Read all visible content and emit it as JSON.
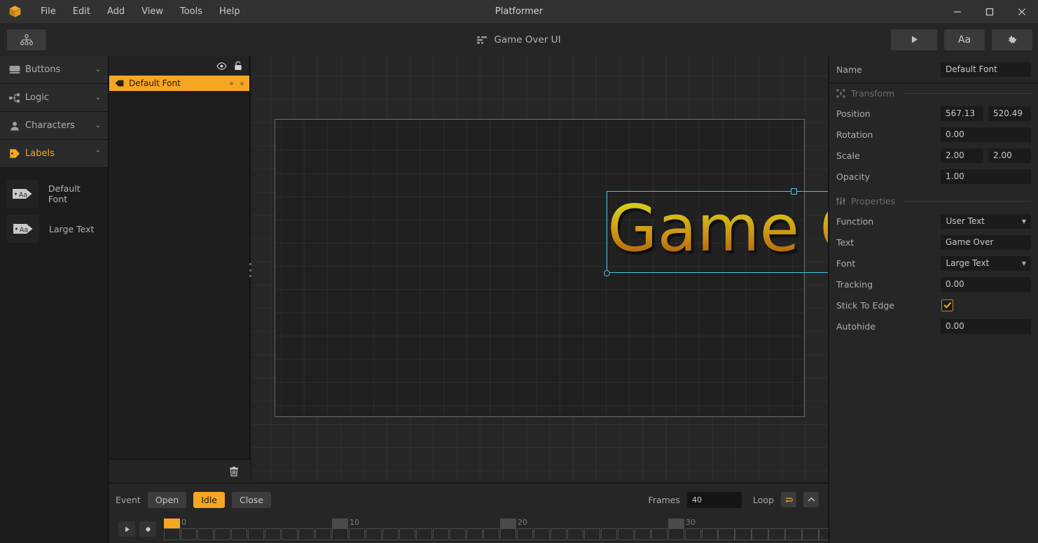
{
  "window": {
    "title": "Platformer",
    "app_icon": "box-logo-icon",
    "minimize_label": "–",
    "maximize_label": "□",
    "close_label": "✕"
  },
  "menubar": {
    "items": [
      {
        "label": "File"
      },
      {
        "label": "Edit"
      },
      {
        "label": "Add"
      },
      {
        "label": "View"
      },
      {
        "label": "Tools"
      },
      {
        "label": "Help"
      }
    ]
  },
  "toolbar": {
    "hierarchy_button_icon": "hierarchy-tree-icon",
    "document_icon": "list-icon",
    "document_title": "Game Over UI",
    "play_label": "▶",
    "text_label": "Aa",
    "settings_icon": "gear-icon"
  },
  "sidebar": {
    "categories": [
      {
        "label": "Buttons",
        "icon": "button-icon",
        "expanded": false,
        "chevron": "⌄"
      },
      {
        "label": "Logic",
        "icon": "logic-node-icon",
        "expanded": false,
        "chevron": "⌄"
      },
      {
        "label": "Characters",
        "icon": "person-icon",
        "expanded": false,
        "chevron": "⌄"
      },
      {
        "label": "Labels",
        "icon": "tag-icon",
        "expanded": true,
        "chevron": "⌃"
      }
    ],
    "assets": [
      {
        "label": "Default Font",
        "icon": "label-aa-icon",
        "thumb_text": "Aa"
      },
      {
        "label": "Large Text",
        "icon": "label-aa-icon",
        "thumb_text": "Aa"
      }
    ]
  },
  "layer_panel": {
    "visibility_icon": "eye-icon",
    "lock_icon": "lock-icon",
    "delete_icon": "trash-icon",
    "layers": [
      {
        "name": "Default Font",
        "icon": "label-layer-icon",
        "selected": true
      }
    ]
  },
  "canvas": {
    "selected_object": "Game Over",
    "object_text": "Game Over",
    "selection_color": "#4cc3e8",
    "text_gradient_top": "#d6e01c",
    "text_gradient_bottom": "#a0530c",
    "handles": [
      "top-center",
      "top-right",
      "middle-right",
      "origin-bottom-left"
    ]
  },
  "timeline": {
    "event_label": "Event",
    "events": [
      {
        "label": "Open",
        "active": false
      },
      {
        "label": "Idle",
        "active": true
      },
      {
        "label": "Close",
        "active": false
      }
    ],
    "frames_label": "Frames",
    "frames_value": "40",
    "loop_label": "Loop",
    "loop_icon": "loop-icon",
    "collapse_icon": "chevron-up-icon",
    "play_icon": "play-icon",
    "record_icon": "record-icon",
    "ruler_ticks": [
      "0",
      "10",
      "20",
      "30"
    ],
    "total_cells": 40,
    "current_frame": 0
  },
  "properties": {
    "name_label": "Name",
    "name_value": "Default Font",
    "transform": {
      "section_label": "Transform",
      "section_icon": "transform-icon",
      "rows": [
        {
          "label": "Position",
          "values": [
            "567.13",
            "520.49"
          ],
          "type": "pair"
        },
        {
          "label": "Rotation",
          "values": [
            "0.00"
          ],
          "type": "single"
        },
        {
          "label": "Scale",
          "values": [
            "2.00",
            "2.00"
          ],
          "type": "pair"
        },
        {
          "label": "Opacity",
          "values": [
            "1.00"
          ],
          "type": "single"
        }
      ]
    },
    "props": {
      "section_label": "Properties",
      "section_icon": "sliders-icon",
      "function_label": "Function",
      "function_value": "User Text",
      "text_label": "Text",
      "text_value": "Game Over",
      "font_label": "Font",
      "font_value": "Large Text",
      "tracking_label": "Tracking",
      "tracking_value": "0.00",
      "stick_label": "Stick To Edge",
      "stick_checked": true,
      "autohide_label": "Autohide",
      "autohide_value": "0.00"
    }
  },
  "colors": {
    "accent": "#f5a623",
    "selection": "#4cc3e8",
    "panel_bg": "#262626",
    "canvas_bg": "#262626"
  }
}
